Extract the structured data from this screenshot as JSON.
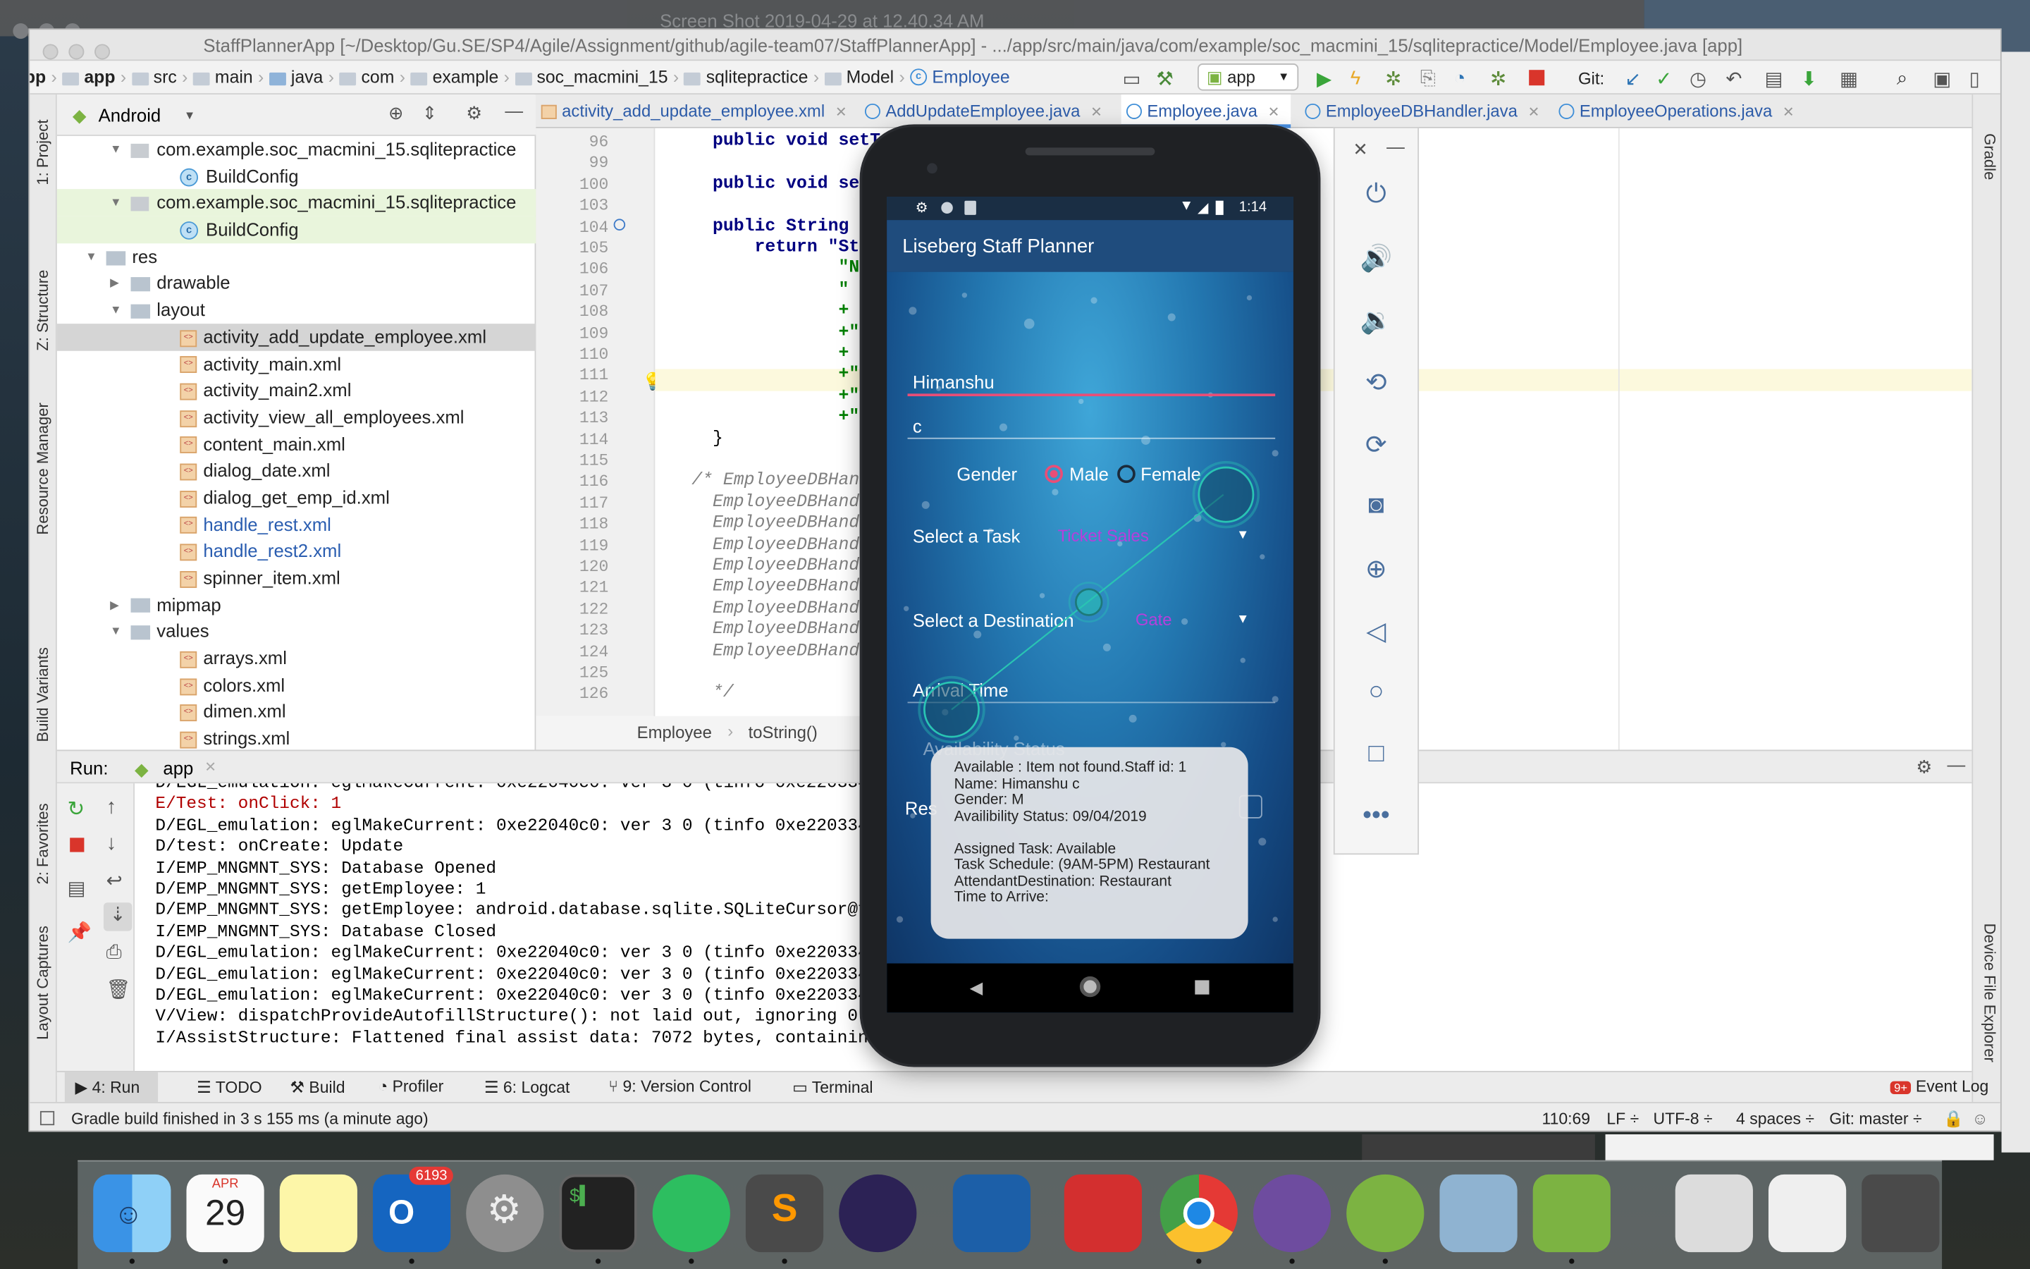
{
  "ghost_title": "Screen Shot 2019-04-29 at 12.40.34 AM",
  "window_title": "StaffPlannerApp [~/Desktop/Gu.SE/SP4/Agile/Assignment/github/agile-team07/StaffPlannerApp] - .../app/src/main/java/com/example/soc_macmini_15/sqlitepractice/Model/Employee.java [app]",
  "breadcrumb": [
    "pp",
    "app",
    "src",
    "main",
    "java",
    "com",
    "example",
    "soc_macmini_15",
    "sqlitepractice",
    "Model",
    "Employee"
  ],
  "toolbar": {
    "run_config": "app",
    "git_label": "Git:"
  },
  "left_strip": [
    "1: Project",
    "Z: Structure",
    "Resource Manager",
    "Build Variants",
    "2: Favorites",
    "Layout Captures"
  ],
  "right_strip": [
    "Gradle",
    "Device File Explorer"
  ],
  "project": {
    "view": "Android",
    "rows": [
      {
        "label": "com.example.soc_macmini_15.sqlitepractice",
        "kind": "pkg",
        "indent": 3,
        "arrow": "down"
      },
      {
        "label": "BuildConfig",
        "kind": "class",
        "indent": 5
      },
      {
        "label": "com.example.soc_macmini_15.sqlitepractice",
        "kind": "pkg",
        "indent": 3,
        "arrow": "down",
        "hl": "green"
      },
      {
        "label": "BuildConfig",
        "kind": "class",
        "indent": 5,
        "hl": "green"
      },
      {
        "label": "res",
        "kind": "folder",
        "indent": 2,
        "arrow": "down"
      },
      {
        "label": "drawable",
        "kind": "folder",
        "indent": 3,
        "arrow": "right"
      },
      {
        "label": "layout",
        "kind": "folder",
        "indent": 3,
        "arrow": "down"
      },
      {
        "label": "activity_add_update_employee.xml",
        "kind": "xml",
        "indent": 5,
        "hl": "sel"
      },
      {
        "label": "activity_main.xml",
        "kind": "xml",
        "indent": 5
      },
      {
        "label": "activity_main2.xml",
        "kind": "xml",
        "indent": 5
      },
      {
        "label": "activity_view_all_employees.xml",
        "kind": "xml",
        "indent": 5
      },
      {
        "label": "content_main.xml",
        "kind": "xml",
        "indent": 5
      },
      {
        "label": "dialog_date.xml",
        "kind": "xml",
        "indent": 5
      },
      {
        "label": "dialog_get_emp_id.xml",
        "kind": "xml",
        "indent": 5
      },
      {
        "label": "handle_rest.xml",
        "kind": "xml",
        "indent": 5,
        "blue": true
      },
      {
        "label": "handle_rest2.xml",
        "kind": "xml",
        "indent": 5,
        "blue": true
      },
      {
        "label": "spinner_item.xml",
        "kind": "xml",
        "indent": 5
      },
      {
        "label": "mipmap",
        "kind": "folder",
        "indent": 3,
        "arrow": "right"
      },
      {
        "label": "values",
        "kind": "folder",
        "indent": 3,
        "arrow": "down"
      },
      {
        "label": "arrays.xml",
        "kind": "xml",
        "indent": 5
      },
      {
        "label": "colors.xml",
        "kind": "xml",
        "indent": 5
      },
      {
        "label": "dimen.xml",
        "kind": "xml",
        "indent": 5
      },
      {
        "label": "strings.xml",
        "kind": "xml",
        "indent": 5
      }
    ]
  },
  "tabs": [
    {
      "label": "activity_add_update_employee.xml",
      "kind": "xml"
    },
    {
      "label": "AddUpdateEmployee.java",
      "kind": "class"
    },
    {
      "label": "Employee.java",
      "kind": "class",
      "active": true
    },
    {
      "label": "EmployeeDBHandler.java",
      "kind": "class"
    },
    {
      "label": "EmployeeOperations.java",
      "kind": "class"
    }
  ],
  "code": [
    {
      "n": "96",
      "t": "    public void setTask(S"
    },
    {
      "n": "99",
      "t": ""
    },
    {
      "n": "100",
      "t": "    public void setStatu"
    },
    {
      "n": "103",
      "t": ""
    },
    {
      "n": "104",
      "t": "    public String toStri"
    },
    {
      "n": "105",
      "t": "        return \"Staff id"
    },
    {
      "n": "106",
      "t": "                \"Name: \""
    },
    {
      "n": "107",
      "t": "                \" \\n\"+\"G"
    },
    {
      "n": "108",
      "t": "                + \"\\n\" +"
    },
    {
      "n": "109",
      "t": "                +\"\\n\" +"
    },
    {
      "n": "110",
      "t": "                + \"\\n\" -"
    },
    {
      "n": "111",
      "t": "                +\"Destin"
    },
    {
      "n": "112",
      "t": "                +\"Time t"
    },
    {
      "n": "113",
      "t": "                +\"\\n\";"
    },
    {
      "n": "114",
      "t": "    }"
    },
    {
      "n": "115",
      "t": ""
    },
    {
      "n": "116",
      "t": "  /* EmployeeDBHandler."
    },
    {
      "n": "117",
      "t": "    EmployeeDBHandler.CO"
    },
    {
      "n": "118",
      "t": "    EmployeeDBHandler.CO"
    },
    {
      "n": "119",
      "t": "    EmployeeDBHandler.CO"
    },
    {
      "n": "120",
      "t": "    EmployeeDBHandler.CO"
    },
    {
      "n": "121",
      "t": "    EmployeeDBHandler.CO"
    },
    {
      "n": "122",
      "t": "    EmployeeDBHandler.CO"
    },
    {
      "n": "123",
      "t": "    EmployeeDBHandler.CO"
    },
    {
      "n": "124",
      "t": "    EmployeeDBHandler.CO"
    },
    {
      "n": "125",
      "t": ""
    },
    {
      "n": "126",
      "t": "    */"
    }
  ],
  "code_footer": [
    "Employee",
    "toString()"
  ],
  "run": {
    "label": "Run:",
    "tab": "app",
    "log": [
      {
        "t": "D/EGL_emulation: eglMakeCurrent: 0xe22040c0: ver 3 0 (tinfo 0xe2203340)",
        "c": "#000"
      },
      {
        "t": "E/Test: onClick: 1",
        "c": "#b00000"
      },
      {
        "t": "D/EGL_emulation: eglMakeCurrent: 0xe22040c0: ver 3 0 (tinfo 0xe2203340)",
        "c": "#000"
      },
      {
        "t": "D/test: onCreate: Update",
        "c": "#000"
      },
      {
        "t": "I/EMP_MNGMNT_SYS: Database Opened",
        "c": "#000"
      },
      {
        "t": "D/EMP_MNGMNT_SYS: getEmployee: 1",
        "c": "#000"
      },
      {
        "t": "D/EMP_MNGMNT_SYS: getEmployee: android.database.sqlite.SQLiteCursor@fdad",
        "c": "#000"
      },
      {
        "t": "I/EMP_MNGMNT_SYS: Database Closed",
        "c": "#000"
      },
      {
        "t": "D/EGL_emulation: eglMakeCurrent: 0xe22040c0: ver 3 0 (tinfo 0xe2203340)",
        "c": "#000"
      },
      {
        "t": "D/EGL_emulation: eglMakeCurrent: 0xe22040c0: ver 3 0 (tinfo 0xe2203340)",
        "c": "#000"
      },
      {
        "t": "D/EGL_emulation: eglMakeCurrent: 0xe22040c0: ver 3 0 (tinfo 0xe2203340)",
        "c": "#000"
      },
      {
        "t": "V/View: dispatchProvideAutofillStructure(): not laid out, ignoring 0 chi",
        "c": "#000"
      },
      {
        "t": "I/AssistStructure: Flattened final assist data: 7072 bytes, containing 1",
        "c": "#000"
      }
    ]
  },
  "bottom_tabs": [
    "4: Run",
    "TODO",
    "Build",
    "Profiler",
    "6: Logcat",
    "9: Version Control",
    "Terminal"
  ],
  "event_log": "Event Log",
  "status": {
    "message": "Gradle build finished in 3 s 155 ms (a minute ago)",
    "position": "110:69",
    "line_sep": "LF",
    "encoding": "UTF-8",
    "indent": "4 spaces",
    "git": "Git: master"
  },
  "phone": {
    "time": "1:14",
    "app_title": "Liseberg Staff Planner",
    "name_value": "Himanshu",
    "surname_value": "c",
    "gender_label": "Gender",
    "male": "Male",
    "female": "Female",
    "task_label": "Select a Task",
    "task_value": "Ticket Sales",
    "dest_label": "Select a Destination",
    "dest_value": "Gate",
    "arrival_label": "Arrival Time",
    "availability_label": "Availability Status",
    "rest_label": "Res",
    "toast": [
      "Available : Item not found.Staff id: 1",
      "Name: Himanshu c",
      "Gender: M",
      "Availibility  Status: 09/04/2019",
      "",
      "Assigned Task: Available",
      "Task Schedule: (9AM-5PM) Restaurant",
      "AttendantDestination: Restaurant",
      "Time to Arrive:"
    ]
  },
  "dock": {
    "calendar_month": "APR",
    "calendar_day": "29",
    "outlook_badge": "6193"
  },
  "colors": {
    "accent": "#4a90e2",
    "pink": "#e94e77",
    "purple": "#b63fdc"
  }
}
